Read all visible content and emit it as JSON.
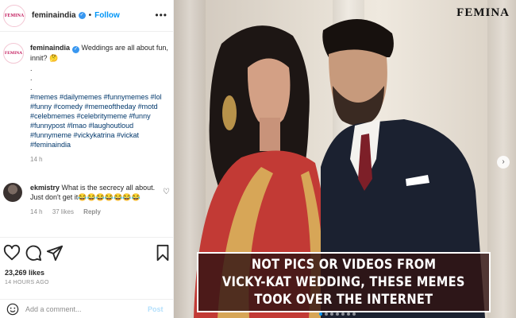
{
  "post": {
    "username": "feminaindia",
    "avatar_text": "FEMINA",
    "follow_label": "Follow",
    "separator": "•",
    "more_label": "•••"
  },
  "caption": {
    "text": "Weddings are all about fun, innit? 🤔",
    "dots": [
      ".",
      ".",
      "."
    ],
    "hashtags": "#memes #dailymemes #funnymemes #lol #funny #comedy #memeoftheday #motd #celebmemes #celebritymeme #funny #funnypost #lmao #laughoutloud #funnymeme #vickykatrina #vickat #feminaindia",
    "time": "14 h"
  },
  "comment": {
    "username": "ekmistry",
    "text": "What is the secrecy all about. Just don't get it😂😂😂😂😂😂😂",
    "time": "14 h",
    "likes": "37 likes",
    "reply": "Reply"
  },
  "stats": {
    "likes": "23,269 likes",
    "ago": "14 HOURS AGO"
  },
  "add_comment": {
    "placeholder": "Add a comment...",
    "post_label": "Post"
  },
  "photo": {
    "brand": "FEMINA",
    "headline": [
      "NOT PICS OR VIDEOS FROM",
      "VICKY-KAT WEDDING, THESE MEMES",
      "TOOK OVER THE INTERNET"
    ],
    "next_arrow": "›",
    "carousel_count": 7,
    "carousel_active": 0
  },
  "colors": {
    "link": "#00376b",
    "follow": "#0095f6",
    "verified": "#3897f0",
    "headline_bg": "#321414"
  }
}
